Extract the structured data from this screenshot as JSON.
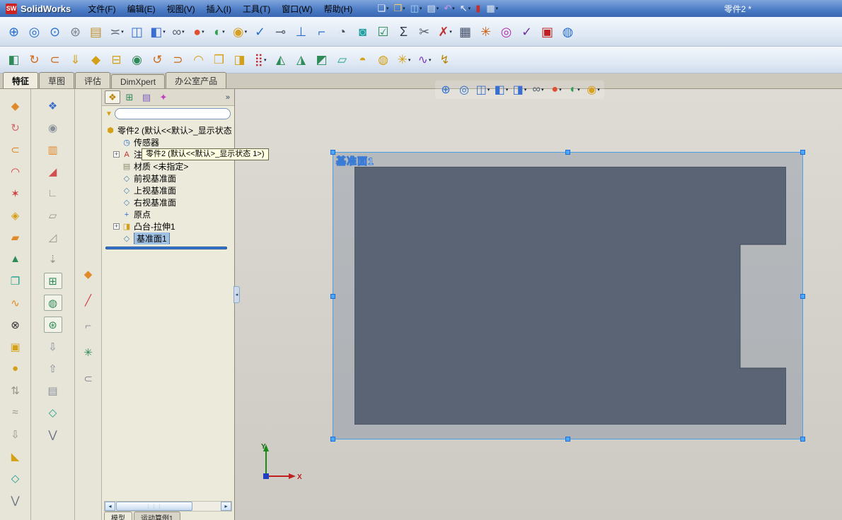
{
  "colors": {
    "selection": "#9ec1e4",
    "accent": "#3a7bd5",
    "tooltip_bg": "#ffffe1"
  },
  "window": {
    "app_name": "SolidWorks",
    "logo_text": "SW",
    "doc_title": "零件2 *",
    "menus": [
      {
        "label": "文件(F)"
      },
      {
        "label": "编辑(E)"
      },
      {
        "label": "视图(V)"
      },
      {
        "label": "插入(I)"
      },
      {
        "label": "工具(T)"
      },
      {
        "label": "窗口(W)"
      },
      {
        "label": "帮助(H)"
      }
    ],
    "quick_icons": [
      {
        "n": "new-document-icon",
        "g": "❏",
        "c": "#f4f7fb",
        "caret": "▾"
      },
      {
        "n": "open-document-icon",
        "g": "❒",
        "c": "#f2cd6a",
        "caret": "▾"
      },
      {
        "n": "save-icon",
        "g": "◫",
        "c": "#a8d4f2",
        "caret": "▾"
      },
      {
        "n": "print-icon",
        "g": "▤",
        "c": "#dce6f2",
        "caret": "▾"
      },
      {
        "n": "undo-icon",
        "g": "↶",
        "c": "#c79ae8",
        "caret": "▾"
      },
      {
        "n": "select-cursor-icon",
        "g": "↖",
        "c": "#f4f7fb",
        "caret": "▾"
      },
      {
        "n": "barcode-icon",
        "g": "▮",
        "c": "#c03030",
        "caret": ""
      },
      {
        "n": "options-grid-icon",
        "g": "▦",
        "c": "#dce6f2",
        "caret": "▾"
      }
    ]
  },
  "toolbars": {
    "standard": [
      {
        "n": "zoom-in-out-icon",
        "g": "⊕",
        "c": "#2a6fd0",
        "caret": ""
      },
      {
        "n": "zoom-to-area-icon",
        "g": "◎",
        "c": "#2a6fd0",
        "caret": ""
      },
      {
        "n": "magnified-selection-icon",
        "g": "⊙",
        "c": "#2a6fd0",
        "caret": ""
      },
      {
        "n": "gears-options-icon",
        "g": "⊛",
        "c": "#78828e",
        "caret": ""
      },
      {
        "n": "design-binder-icon",
        "g": "▤",
        "c": "#c09030",
        "caret": ""
      },
      {
        "n": "measure-icon",
        "g": "≍",
        "c": "#667080",
        "caret": "▾"
      },
      {
        "n": "section-view-icon",
        "g": "◫",
        "c": "#3a6fd0",
        "caret": ""
      },
      {
        "n": "view-orientation-icon",
        "g": "◧",
        "c": "#3a6fd0",
        "caret": "▾"
      },
      {
        "n": "hide-show-items-icon",
        "g": "∞",
        "c": "#556070",
        "caret": "▾"
      },
      {
        "n": "appearances-sphere-icon",
        "g": "●",
        "c": "#e05030",
        "caret": "▾"
      },
      {
        "n": "scene-sphere-icon",
        "g": "◐",
        "c": "#30a050",
        "caret": "▾"
      },
      {
        "n": "realview-sphere-icon",
        "g": "◉",
        "c": "#d8a020",
        "caret": "▾"
      },
      {
        "n": "spell-check-icon",
        "g": "✓",
        "c": "#2a6fd0",
        "caret": ""
      },
      {
        "n": "note-callout-icon",
        "g": "⊸",
        "c": "#556070",
        "caret": ""
      },
      {
        "n": "datum-icon",
        "g": "⊥",
        "c": "#2a6fd0",
        "caret": ""
      },
      {
        "n": "surface-finish-icon",
        "g": "⌐",
        "c": "#2a6fd0",
        "caret": ""
      },
      {
        "n": "performance-clock-icon",
        "g": "◔",
        "c": "#445060",
        "caret": ""
      },
      {
        "n": "camera-icon",
        "g": "◙",
        "c": "#20a0a0",
        "caret": ""
      },
      {
        "n": "design-check-icon",
        "g": "☑",
        "c": "#2e8b57",
        "caret": ""
      },
      {
        "n": "equations-icon",
        "g": "Σ",
        "c": "#303a48",
        "caret": ""
      },
      {
        "n": "split-icon",
        "g": "✂",
        "c": "#556070",
        "caret": ""
      },
      {
        "n": "check-entity-icon",
        "g": "✗",
        "c": "#c03030",
        "caret": "▾"
      },
      {
        "n": "design-table-icon",
        "g": "▦",
        "c": "#44506a",
        "caret": ""
      },
      {
        "n": "exploded-view-icon",
        "g": "✳",
        "c": "#d06010",
        "caret": ""
      },
      {
        "n": "realview-rings-icon",
        "g": "◎",
        "c": "#b030b0",
        "caret": ""
      },
      {
        "n": "approve-check-icon",
        "g": "✓",
        "c": "#7030a0",
        "caret": ""
      },
      {
        "n": "color-swatch-icon",
        "g": "▣",
        "c": "#c02020",
        "caret": ""
      },
      {
        "n": "help-sphere-icon",
        "g": "◍",
        "c": "#2a6fd0",
        "caret": ""
      }
    ],
    "features": [
      {
        "n": "extruded-boss-icon",
        "g": "◧",
        "c": "#2e8b57",
        "caret": ""
      },
      {
        "n": "revolved-boss-icon",
        "g": "↻",
        "c": "#cc6a1a",
        "caret": ""
      },
      {
        "n": "swept-boss-icon",
        "g": "⊂",
        "c": "#cc6a1a",
        "caret": ""
      },
      {
        "n": "lofted-boss-icon",
        "g": "⇓",
        "c": "#d4a017",
        "caret": ""
      },
      {
        "n": "boundary-boss-icon",
        "g": "◆",
        "c": "#d4a017",
        "caret": ""
      },
      {
        "n": "extruded-cut-icon",
        "g": "⊟",
        "c": "#d4a017",
        "caret": ""
      },
      {
        "n": "hole-wizard-icon",
        "g": "◉",
        "c": "#2e8b57",
        "caret": ""
      },
      {
        "n": "revolved-cut-icon",
        "g": "↺",
        "c": "#cc6a1a",
        "caret": ""
      },
      {
        "n": "swept-cut-icon",
        "g": "⊃",
        "c": "#cc6a1a",
        "caret": ""
      },
      {
        "n": "fillet-icon",
        "g": "◠",
        "c": "#d4a017",
        "caret": ""
      },
      {
        "n": "insert-part-folder-icon",
        "g": "❒",
        "c": "#d4a017",
        "caret": ""
      },
      {
        "n": "shell-icon",
        "g": "◨",
        "c": "#d4a017",
        "caret": ""
      },
      {
        "n": "linear-pattern-icon",
        "g": "⣿",
        "c": "#c03030",
        "caret": "▾"
      },
      {
        "n": "mirror-icon",
        "g": "◭",
        "c": "#2e8b57",
        "caret": ""
      },
      {
        "n": "draft-icon",
        "g": "◮",
        "c": "#2e8b57",
        "caret": ""
      },
      {
        "n": "rib-icon",
        "g": "◩",
        "c": "#2e8b57",
        "caret": ""
      },
      {
        "n": "reference-plane-icon",
        "g": "▱",
        "c": "#20a090",
        "caret": ""
      },
      {
        "n": "dome-icon",
        "g": "◓",
        "c": "#d4a017",
        "caret": ""
      },
      {
        "n": "wrap-icon",
        "g": "◍",
        "c": "#d4a017",
        "caret": ""
      },
      {
        "n": "freeform-icon",
        "g": "✳",
        "c": "#d4a017",
        "caret": "▾"
      },
      {
        "n": "flex-icon",
        "g": "∿",
        "c": "#8040c0",
        "caret": "▾"
      },
      {
        "n": "deform-icon",
        "g": "↯",
        "c": "#b8860b",
        "caret": ""
      }
    ]
  },
  "command_tabs": [
    {
      "label": "特征",
      "cls": "active"
    },
    {
      "label": "草图",
      "cls": ""
    },
    {
      "label": "评估",
      "cls": ""
    },
    {
      "label": "DimXpert",
      "cls": ""
    },
    {
      "label": "办公室产品",
      "cls": ""
    }
  ],
  "left_toolbar_a": [
    {
      "n": "boss-extrude-flyout-icon",
      "g": "◆",
      "c": "#e08a2a"
    },
    {
      "n": "revolve-flyout-icon",
      "g": "↻",
      "c": "#d06a6a"
    },
    {
      "n": "sweep-flyout-icon",
      "g": "⊂",
      "c": "#e08a2a"
    },
    {
      "n": "loft-flyout-icon",
      "g": "◠",
      "c": "#d04040"
    },
    {
      "n": "boundary-flyout-icon",
      "g": "✶",
      "c": "#d04040"
    },
    {
      "n": "fillet-flyout-icon",
      "g": "◈",
      "c": "#d4a017"
    },
    {
      "n": "pattern-flyout-icon",
      "g": "▰",
      "c": "#e08a2a"
    },
    {
      "n": "draft-flyout-icon",
      "g": "▲",
      "c": "#2e8b57"
    },
    {
      "n": "shell-copy-icon",
      "g": "❐",
      "c": "#20a090"
    },
    {
      "n": "flex-wave-icon",
      "g": "∿",
      "c": "#e08a2a"
    },
    {
      "n": "delete-face-icon",
      "g": "⊗",
      "c": "#333333"
    },
    {
      "n": "boss-block-icon",
      "g": "▣",
      "c": "#d4a017"
    },
    {
      "n": "cylinder-boss-icon",
      "g": "●",
      "c": "#d4a017"
    },
    {
      "n": "move-face-icon",
      "g": "⇅",
      "c": "#98948a"
    },
    {
      "n": "deform-surface-icon",
      "g": "≈",
      "c": "#98948a"
    },
    {
      "n": "indent-icon",
      "g": "⇩",
      "c": "#98948a"
    },
    {
      "n": "wedge-icon",
      "g": "◣",
      "c": "#d4a017"
    },
    {
      "n": "intersect-icon",
      "g": "◇",
      "c": "#20a090"
    },
    {
      "n": "more-tools-chevron-icon",
      "g": "⋁",
      "c": "#667080"
    }
  ],
  "left_toolbar_b": [
    {
      "n": "sheet-metal-icon",
      "g": "❖",
      "c": "#3a6fd0",
      "cls": ""
    },
    {
      "n": "mouse-gesture-icon",
      "g": "◉",
      "c": "#88909a",
      "cls": ""
    },
    {
      "n": "evaluate-chart-icon",
      "g": "▥",
      "c": "#e08a2a",
      "cls": ""
    },
    {
      "n": "bend-icon",
      "g": "◢",
      "c": "#d05050",
      "cls": ""
    },
    {
      "n": "corner-icon",
      "g": "∟",
      "c": "#98948a",
      "cls": ""
    },
    {
      "n": "plane-gray-icon",
      "g": "▱",
      "c": "#98948a",
      "cls": ""
    },
    {
      "n": "ramp-icon",
      "g": "◿",
      "c": "#98948a",
      "cls": ""
    },
    {
      "n": "drop-tool-icon",
      "g": "⇣",
      "c": "#98948a",
      "cls": ""
    },
    {
      "n": "grid-system-icon",
      "g": "⊞",
      "c": "#2e8b57",
      "cls": "boxed"
    },
    {
      "n": "sphere-tool-icon",
      "g": "◍",
      "c": "#2e8b57",
      "cls": "boxed"
    },
    {
      "n": "wheel-tool-icon",
      "g": "⊛",
      "c": "#2e8b57",
      "cls": "boxed"
    },
    {
      "n": "arrow-down-tool-icon",
      "g": "⇩",
      "c": "#88909a",
      "cls": ""
    },
    {
      "n": "arrow-up-tool-icon",
      "g": "⇧",
      "c": "#88909a",
      "cls": ""
    },
    {
      "n": "layers-icon",
      "g": "▤",
      "c": "#88909a",
      "cls": ""
    },
    {
      "n": "diamond-tool-icon",
      "g": "◇",
      "c": "#20a090",
      "cls": ""
    },
    {
      "n": "more-chevron-icon",
      "g": "⋁",
      "c": "#667080",
      "cls": ""
    }
  ],
  "left_toolbar_c": [
    {
      "n": "freeform-diamond-icon",
      "g": "◆",
      "c": "#e08a2a"
    },
    {
      "n": "split-line-icon",
      "g": "╱",
      "c": "#d04040"
    },
    {
      "n": "corner-bracket-icon",
      "g": "⌐",
      "c": "#88909a"
    },
    {
      "n": "axis-asterisk-icon",
      "g": "✳",
      "c": "#2e8b57"
    },
    {
      "n": "attachment-clip-icon",
      "g": "⊂",
      "c": "#88909a"
    }
  ],
  "panel": {
    "tabs": [
      {
        "n": "featuremanager-tree-tab",
        "g": "❖",
        "c": "#b8860b",
        "cls": "active"
      },
      {
        "n": "propertymanager-tab",
        "g": "⊞",
        "c": "#2e8b57",
        "cls": ""
      },
      {
        "n": "configurationmanager-tab",
        "g": "▤",
        "c": "#8060c0",
        "cls": ""
      },
      {
        "n": "dimxpertmanager-tab",
        "g": "✦",
        "c": "#c040c0",
        "cls": ""
      }
    ],
    "more_chevron": "»",
    "filter": {
      "value": "",
      "funnel_glyph": "▼"
    },
    "tree": {
      "root_label": "零件2 (默认<<默认>_显示状态 1>)",
      "items": [
        {
          "n": "tree-item-sensors",
          "exp": "",
          "icon": "◷",
          "ic": "#2a6fd0",
          "label": "传感器",
          "cls": ""
        },
        {
          "n": "tree-item-annotations",
          "exp": "+",
          "icon": "A",
          "ic": "#c03030",
          "label": "注解",
          "cls": ""
        },
        {
          "n": "tree-item-material",
          "exp": "",
          "icon": "▤",
          "ic": "#8a8a6a",
          "label": "材质 <未指定>",
          "cls": ""
        },
        {
          "n": "tree-item-front-plane",
          "exp": "",
          "icon": "◇",
          "ic": "#4682b4",
          "label": "前视基准面",
          "cls": ""
        },
        {
          "n": "tree-item-top-plane",
          "exp": "",
          "icon": "◇",
          "ic": "#4682b4",
          "label": "上视基准面",
          "cls": ""
        },
        {
          "n": "tree-item-right-plane",
          "exp": "",
          "icon": "◇",
          "ic": "#4682b4",
          "label": "右视基准面",
          "cls": ""
        },
        {
          "n": "tree-item-origin",
          "exp": "",
          "icon": "+",
          "ic": "#2a6fd0",
          "label": "原点",
          "cls": ""
        },
        {
          "n": "tree-item-boss-extrude1",
          "exp": "+",
          "icon": "◨",
          "ic": "#d4a017",
          "label": "凸台-拉伸1",
          "cls": ""
        },
        {
          "n": "tree-item-plane1",
          "exp": "",
          "icon": "◇",
          "ic": "#4682b4",
          "label": "基准面1",
          "cls": "selected"
        }
      ]
    },
    "scrollbar": {
      "left_arrow": "◂",
      "right_arrow": "▸",
      "grip": "⋮⋮⋮"
    },
    "bottom_tabs": [
      {
        "label": "模型",
        "cls": "active"
      },
      {
        "label": "运动算例1",
        "cls": ""
      }
    ]
  },
  "headsup": [
    {
      "n": "hu-zoom-to-fit-icon",
      "g": "⊕",
      "c": "#2a6fd0",
      "caret": ""
    },
    {
      "n": "hu-zoom-to-area-icon",
      "g": "◎",
      "c": "#2a6fd0",
      "caret": ""
    },
    {
      "n": "hu-section-view-icon",
      "g": "◫",
      "c": "#3a6fd0",
      "caret": "▾"
    },
    {
      "n": "hu-view-orientation-icon",
      "g": "◧",
      "c": "#3a6fd0",
      "caret": "▾"
    },
    {
      "n": "hu-display-style-icon",
      "g": "◨",
      "c": "#3a6fd0",
      "caret": "▾"
    },
    {
      "n": "hu-hide-show-items-icon",
      "g": "∞",
      "c": "#556070",
      "caret": "▾"
    },
    {
      "n": "hu-edit-appearance-icon",
      "g": "●",
      "c": "#e05030",
      "caret": "▾"
    },
    {
      "n": "hu-apply-scene-icon",
      "g": "◐",
      "c": "#30a050",
      "caret": "▾"
    },
    {
      "n": "hu-view-settings-icon",
      "g": "◉",
      "c": "#d8a020",
      "caret": "▾"
    }
  ],
  "tooltip": {
    "text": "零件2  (默认<<默认>_显示状态 1>)"
  },
  "viewport": {
    "plane_label": "基准面1",
    "triad": {
      "x_label": "X",
      "y_label": "Y"
    },
    "colors": {
      "part": "#5a6474",
      "plane_fill": "rgba(70,95,130,0.25)",
      "plane_border": "#4aa0e8",
      "handle": "#4da6ff"
    }
  }
}
